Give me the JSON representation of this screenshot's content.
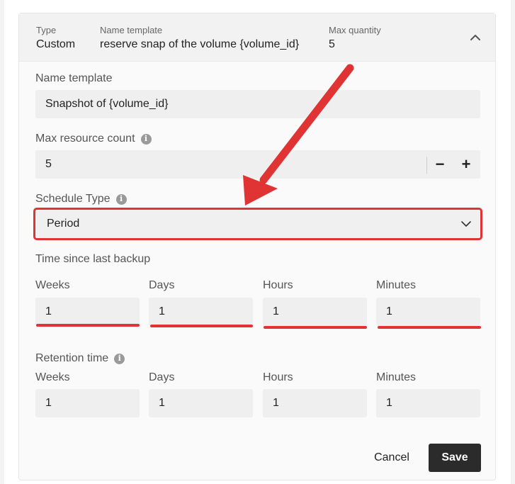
{
  "header": {
    "type_label": "Type",
    "type_value": "Custom",
    "name_template_label": "Name template",
    "name_template_value": "reserve snap of the volume {volume_id}",
    "max_quantity_label": "Max quantity",
    "max_quantity_value": "5"
  },
  "form": {
    "name_template": {
      "label": "Name template",
      "value": "Snapshot of {volume_id}"
    },
    "max_resource_count": {
      "label": "Max resource count",
      "value": "5",
      "info_icon": "i",
      "minus": "−",
      "plus": "+"
    },
    "schedule_type": {
      "label": "Schedule Type",
      "value": "Period",
      "info_icon": "i"
    },
    "time_since_last_backup": {
      "label": "Time since last backup",
      "fields": [
        {
          "label": "Weeks",
          "value": "1"
        },
        {
          "label": "Days",
          "value": "1"
        },
        {
          "label": "Hours",
          "value": "1"
        },
        {
          "label": "Minutes",
          "value": "1"
        }
      ]
    },
    "retention_time": {
      "label": "Retention time",
      "info_icon": "i",
      "fields": [
        {
          "label": "Weeks",
          "value": "1"
        },
        {
          "label": "Days",
          "value": "1"
        },
        {
          "label": "Hours",
          "value": "1"
        },
        {
          "label": "Minutes",
          "value": "1"
        }
      ]
    }
  },
  "actions": {
    "cancel": "Cancel",
    "save": "Save"
  },
  "colors": {
    "annotation_red": "#e03333",
    "save_bg": "#2b2b2b",
    "input_bg": "#efefef"
  }
}
